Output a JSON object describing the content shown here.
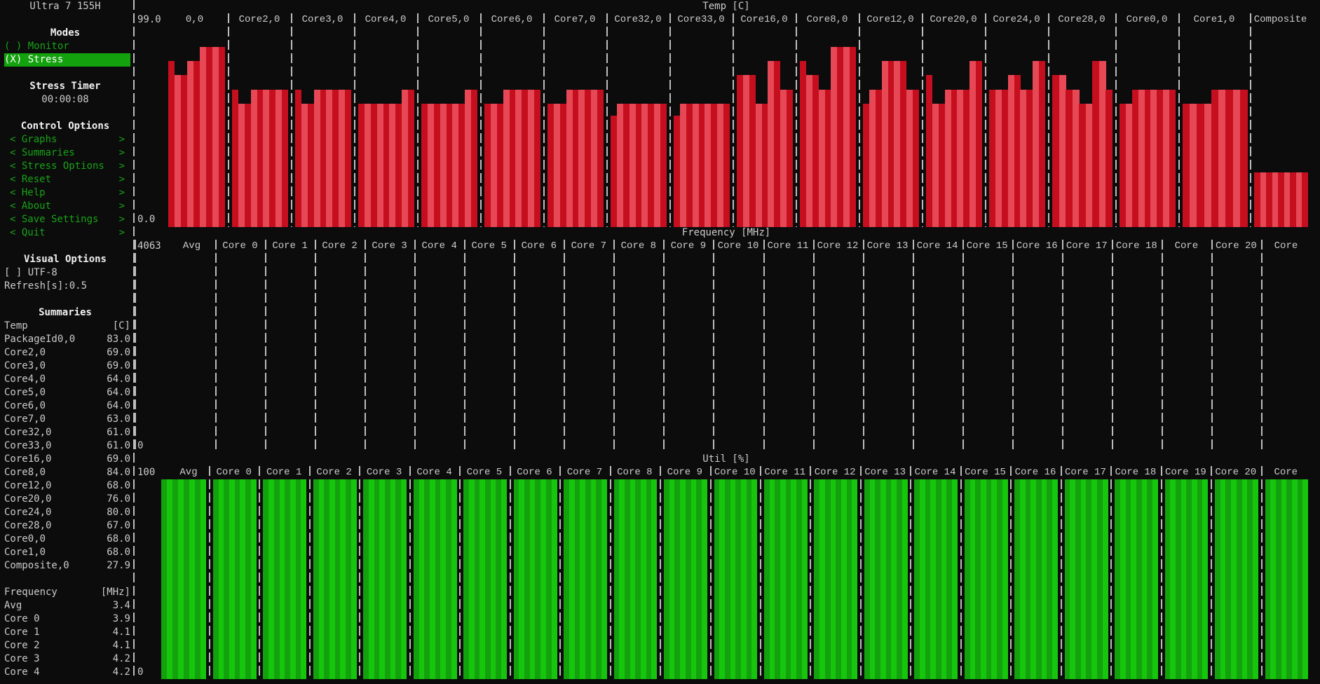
{
  "header": {
    "cpu_name": "Ultra 7 155H"
  },
  "modes": {
    "title": "Modes",
    "options": [
      {
        "label": "( ) Monitor",
        "selected": false
      },
      {
        "label": "(X) Stress",
        "selected": true
      }
    ]
  },
  "stress_timer": {
    "title": "Stress Timer",
    "value": "00:00:08"
  },
  "control_options": {
    "title": "Control Options",
    "items": [
      {
        "label": "< Graphs",
        "arrow": ">"
      },
      {
        "label": "< Summaries",
        "arrow": ">"
      },
      {
        "label": "< Stress Options",
        "arrow": ">"
      },
      {
        "label": "< Reset",
        "arrow": ">"
      },
      {
        "label": "< Help",
        "arrow": ">"
      },
      {
        "label": "< About",
        "arrow": ">"
      },
      {
        "label": "< Save Settings",
        "arrow": ">"
      },
      {
        "label": "< Quit",
        "arrow": ">"
      }
    ]
  },
  "visual_options": {
    "title": "Visual Options",
    "utf8": "[ ] UTF-8",
    "refresh": "Refresh[s]:0.5"
  },
  "summaries": {
    "title": "Summaries",
    "temp": {
      "label": "Temp",
      "unit": "[C]",
      "rows": [
        {
          "name": "PackageId0,0",
          "value": "83.0"
        },
        {
          "name": "Core2,0",
          "value": "69.0"
        },
        {
          "name": "Core3,0",
          "value": "69.0"
        },
        {
          "name": "Core4,0",
          "value": "64.0"
        },
        {
          "name": "Core5,0",
          "value": "64.0"
        },
        {
          "name": "Core6,0",
          "value": "64.0"
        },
        {
          "name": "Core7,0",
          "value": "63.0"
        },
        {
          "name": "Core32,0",
          "value": "61.0"
        },
        {
          "name": "Core33,0",
          "value": "61.0"
        },
        {
          "name": "Core16,0",
          "value": "69.0"
        },
        {
          "name": "Core8,0",
          "value": "84.0"
        },
        {
          "name": "Core12,0",
          "value": "68.0"
        },
        {
          "name": "Core20,0",
          "value": "76.0"
        },
        {
          "name": "Core24,0",
          "value": "80.0"
        },
        {
          "name": "Core28,0",
          "value": "67.0"
        },
        {
          "name": "Core0,0",
          "value": "68.0"
        },
        {
          "name": "Core1,0",
          "value": "68.0"
        },
        {
          "name": "Composite,0",
          "value": "27.9"
        }
      ]
    },
    "frequency": {
      "label": "Frequency",
      "unit": "[MHz]",
      "rows": [
        {
          "name": "Avg",
          "value": "3.4"
        },
        {
          "name": "Core 0",
          "value": "3.9"
        },
        {
          "name": "Core 1",
          "value": "4.1"
        },
        {
          "name": "Core 2",
          "value": "4.1"
        },
        {
          "name": "Core 3",
          "value": "4.2"
        },
        {
          "name": "Core 4",
          "value": "4.2"
        }
      ]
    }
  },
  "colors": {
    "background": "#0c0c0c",
    "temp_dark": "#c50f1f",
    "temp_light": "#e74856",
    "util_dark": "#13a10e",
    "util_light": "#16c60c"
  },
  "chart_data": [
    {
      "type": "bar",
      "title": "Temp [C]",
      "ymax_label": "99.0",
      "ymin_label": "0.0",
      "ylim": [
        0,
        99
      ],
      "series": [
        {
          "name": "0,0",
          "values": [
            82,
            75,
            75,
            82,
            82,
            89,
            89,
            89,
            89
          ]
        },
        {
          "name": "Core2,0",
          "values": [
            68,
            61,
            61,
            68,
            68,
            68,
            68,
            68,
            68
          ]
        },
        {
          "name": "Core3,0",
          "values": [
            68,
            61,
            61,
            68,
            68,
            68,
            68,
            68,
            68
          ]
        },
        {
          "name": "Core4,0",
          "values": [
            61,
            61,
            61,
            61,
            61,
            61,
            61,
            68,
            68
          ]
        },
        {
          "name": "Core5,0",
          "values": [
            61,
            61,
            61,
            61,
            61,
            61,
            61,
            68,
            68
          ]
        },
        {
          "name": "Core6,0",
          "values": [
            61,
            61,
            61,
            68,
            68,
            68,
            68,
            68,
            68
          ]
        },
        {
          "name": "Core7,0",
          "values": [
            61,
            61,
            61,
            68,
            68,
            68,
            68,
            68,
            68
          ]
        },
        {
          "name": "Core32,0",
          "values": [
            55,
            61,
            61,
            61,
            61,
            61,
            61,
            61,
            61
          ]
        },
        {
          "name": "Core33,0",
          "values": [
            55,
            61,
            61,
            61,
            61,
            61,
            61,
            61,
            61
          ]
        },
        {
          "name": "Core16,0",
          "values": [
            75,
            75,
            75,
            61,
            61,
            82,
            82,
            68,
            68
          ]
        },
        {
          "name": "Core8,0",
          "values": [
            82,
            75,
            75,
            68,
            68,
            89,
            89,
            89,
            89
          ]
        },
        {
          "name": "Core12,0",
          "values": [
            61,
            68,
            68,
            82,
            82,
            82,
            82,
            68,
            68
          ]
        },
        {
          "name": "Core20,0",
          "values": [
            75,
            61,
            61,
            68,
            68,
            68,
            68,
            82,
            82
          ]
        },
        {
          "name": "Core24,0",
          "values": [
            68,
            68,
            68,
            75,
            75,
            68,
            68,
            82,
            82
          ]
        },
        {
          "name": "Core28,0",
          "values": [
            75,
            75,
            68,
            68,
            61,
            61,
            82,
            82,
            68
          ]
        },
        {
          "name": "Core0,0",
          "values": [
            61,
            61,
            68,
            68,
            68,
            68,
            68,
            68,
            68
          ]
        },
        {
          "name": "Core1,0",
          "values": [
            61,
            61,
            61,
            61,
            68,
            68,
            68,
            68,
            68
          ]
        },
        {
          "name": "Composite",
          "values": [
            27,
            27,
            27,
            27,
            27,
            27,
            27,
            27,
            27
          ]
        }
      ]
    },
    {
      "type": "bar",
      "title": "Frequency [MHz]",
      "ymax_label": "4063",
      "ymin_label": "0",
      "ylim": [
        0,
        4063
      ],
      "categories": [
        "Avg",
        "Core 0",
        "Core 1",
        "Core 2",
        "Core 3",
        "Core 4",
        "Core 5",
        "Core 6",
        "Core 7",
        "Core 8",
        "Core 9",
        "Core 10",
        "Core 11",
        "Core 12",
        "Core 13",
        "Core 14",
        "Core 15",
        "Core 16",
        "Core 17",
        "Core 18",
        "Core",
        "Core 20",
        "Core"
      ],
      "values": []
    },
    {
      "type": "bar",
      "title": "Util [%]",
      "ymax_label": "100",
      "ymin_label": "0",
      "ylim": [
        0,
        100
      ],
      "categories": [
        "Avg",
        "Core 0",
        "Core 1",
        "Core 2",
        "Core 3",
        "Core 4",
        "Core 5",
        "Core 6",
        "Core 7",
        "Core 8",
        "Core 9",
        "Core 10",
        "Core 11",
        "Core 12",
        "Core 13",
        "Core 14",
        "Core 15",
        "Core 16",
        "Core 17",
        "Core 18",
        "Core 19",
        "Core 20",
        "Core"
      ],
      "values": [
        100,
        100,
        100,
        100,
        100,
        100,
        100,
        100,
        100,
        100,
        100,
        100,
        100,
        100,
        100,
        100,
        100,
        100,
        100,
        100,
        100,
        100,
        100
      ]
    }
  ]
}
